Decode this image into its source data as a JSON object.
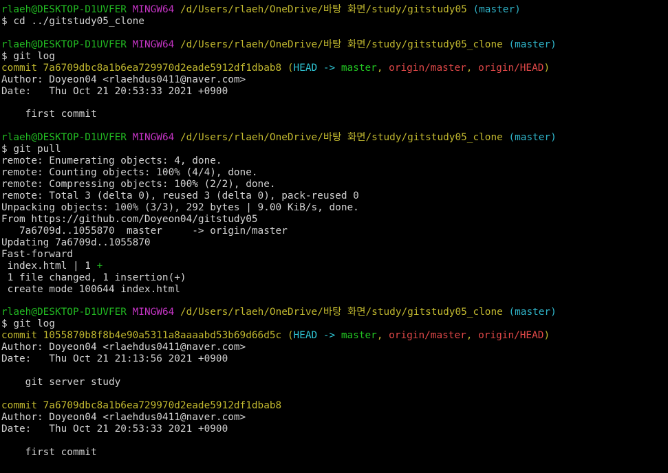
{
  "colors": {
    "background": "#000000",
    "text": "#d3d3d3",
    "user_host": "#22bb22",
    "mingw": "#c334c3",
    "path": "#c1b82f",
    "branch": "#2fb4c9",
    "head": "#2fc7d6",
    "local_branch": "#22c422",
    "remote_ref": "#e04848"
  },
  "prompt": {
    "user_host": "rlaeh@DESKTOP-D1UVFER",
    "system": "MINGW64",
    "path_1": "/d/Users/rlaeh/OneDrive/바탕 화면/study/gitstudy05",
    "path_2": "/d/Users/rlaeh/OneDrive/바탕 화면/study/gitstudy05_clone",
    "branch": "(master)"
  },
  "commands": {
    "cd": "$ cd ../gitstudy05_clone",
    "log": "$ git log",
    "pull": "$ git pull"
  },
  "log1": {
    "commit": "commit 7a6709dbc8a1b6ea729970d2eade5912df1dbab8",
    "author": "Author: Doyeon04 <rlaehdus0411@naver.com>",
    "date": "Date:   Thu Oct 21 20:53:33 2021 +0900",
    "message": "    first commit"
  },
  "decoration": {
    "open": " (",
    "head": "HEAD -> ",
    "master": "master",
    "sep1": ", ",
    "origin_master": "origin/master",
    "sep2": ", ",
    "origin_head": "origin/HEAD",
    "close": ")"
  },
  "pull_output": [
    "remote: Enumerating objects: 4, done.",
    "remote: Counting objects: 100% (4/4), done.",
    "remote: Compressing objects: 100% (2/2), done.",
    "remote: Total 3 (delta 0), reused 3 (delta 0), pack-reused 0",
    "Unpacking objects: 100% (3/3), 292 bytes | 9.00 KiB/s, done.",
    "From https://github.com/Doyeon04/gitstudy05",
    "   7a6709d..1055870  master     -> origin/master",
    "Updating 7a6709d..1055870",
    "Fast-forward"
  ],
  "diffstat": {
    "file": " index.html | 1 ",
    "plus": "+",
    "summary": " 1 file changed, 1 insertion(+)",
    "create": " create mode 100644 index.html"
  },
  "log2": {
    "commit": "commit 1055870b8f8b4e90a5311a8aaaabd53b69d66d5c",
    "author": "Author: Doyeon04 <rlaehdus0411@naver.com>",
    "date": "Date:   Thu Oct 21 21:13:56 2021 +0900",
    "message": "    git server study"
  },
  "log3": {
    "commit": "commit 7a6709dbc8a1b6ea729970d2eade5912df1dbab8",
    "author": "Author: Doyeon04 <rlaehdus0411@naver.com>",
    "date": "Date:   Thu Oct 21 20:53:33 2021 +0900",
    "message": "    first commit"
  }
}
